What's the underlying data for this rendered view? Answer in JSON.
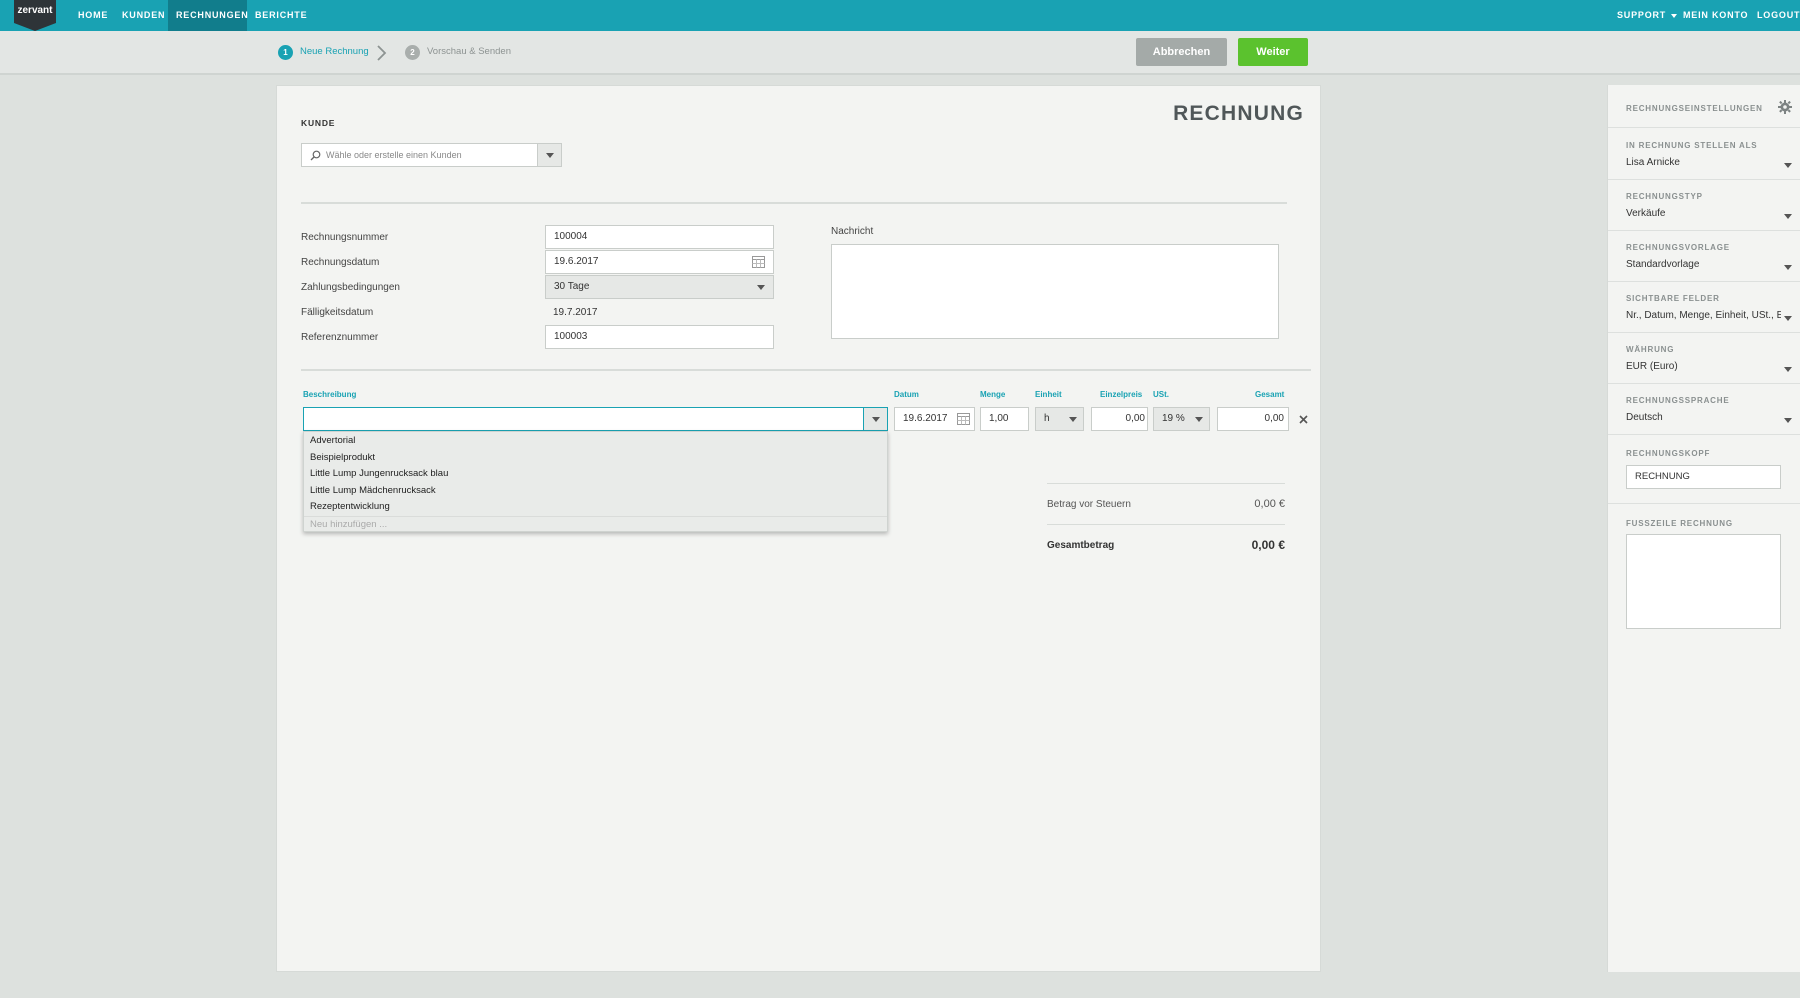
{
  "nav": {
    "logo": "zervant",
    "items": [
      "HOME",
      "KUNDEN",
      "RECHNUNGEN",
      "BERICHTE"
    ],
    "right": {
      "support": "SUPPORT",
      "account": "MEIN KONTO",
      "logout": "LOGOUT"
    }
  },
  "steps": {
    "step1": {
      "num": "1",
      "label": "Neue Rechnung"
    },
    "step2": {
      "num": "2",
      "label": "Vorschau & Senden"
    }
  },
  "actions": {
    "cancel": "Abbrechen",
    "next": "Weiter"
  },
  "colors": {
    "accent": "#19a2b3",
    "nav_active": "#117d8c",
    "next_button": "#5bc22e",
    "cancel_button": "#a4aaa8"
  },
  "invoice": {
    "title": "RECHNUNG",
    "customer_label": "KUNDE",
    "customer_placeholder": "Wähle oder erstelle einen Kunden",
    "fields": {
      "number": {
        "label": "Rechnungsnummer",
        "value": "100004"
      },
      "date": {
        "label": "Rechnungsdatum",
        "value": "19.6.2017"
      },
      "terms": {
        "label": "Zahlungsbedingungen",
        "value": "30 Tage"
      },
      "due": {
        "label": "Fälligkeitsdatum",
        "value": "19.7.2017"
      },
      "reference": {
        "label": "Referenznummer",
        "value": "100003"
      }
    },
    "message_label": "Nachricht",
    "columns": {
      "description": "Beschreibung",
      "date": "Datum",
      "qty": "Menge",
      "unit": "Einheit",
      "price": "Einzelpreis",
      "vat": "USt.",
      "total": "Gesamt"
    },
    "line": {
      "description": "",
      "date": "19.6.2017",
      "qty": "1,00",
      "unit": "h",
      "price": "0,00",
      "vat": "19 %",
      "total": "0,00"
    },
    "dropdown": {
      "items": [
        "Advertorial",
        "Beispielprodukt",
        "Little Lump Jungenrucksack blau",
        "Little Lump Mädchenrucksack",
        "Rezeptentwicklung"
      ],
      "add_new": "Neu hinzufügen ..."
    },
    "summary": {
      "pretax_label": "Betrag vor Steuern",
      "pretax_value": "0,00 €",
      "total_label": "Gesamtbetrag",
      "total_value": "0,00 €"
    }
  },
  "settings": {
    "title": "RECHNUNGSEINSTELLUNGEN",
    "invoice_as": {
      "label": "IN RECHNUNG STELLEN ALS",
      "value": "Lisa Arnicke"
    },
    "type": {
      "label": "RECHNUNGSTYP",
      "value": "Verkäufe"
    },
    "template": {
      "label": "RECHNUNGSVORLAGE",
      "value": "Standardvorlage"
    },
    "visible_fields": {
      "label": "SICHTBARE FELDER",
      "value": "Nr., Datum, Menge, Einheit, USt., Ei..."
    },
    "currency": {
      "label": "WÄHRUNG",
      "value": "EUR (Euro)"
    },
    "language": {
      "label": "RECHNUNGSSPRACHE",
      "value": "Deutsch"
    },
    "header": {
      "label": "RECHNUNGSKOPF",
      "value": "RECHNUNG"
    },
    "footer": {
      "label": "FUSSZEILE RECHNUNG",
      "value": ""
    }
  }
}
